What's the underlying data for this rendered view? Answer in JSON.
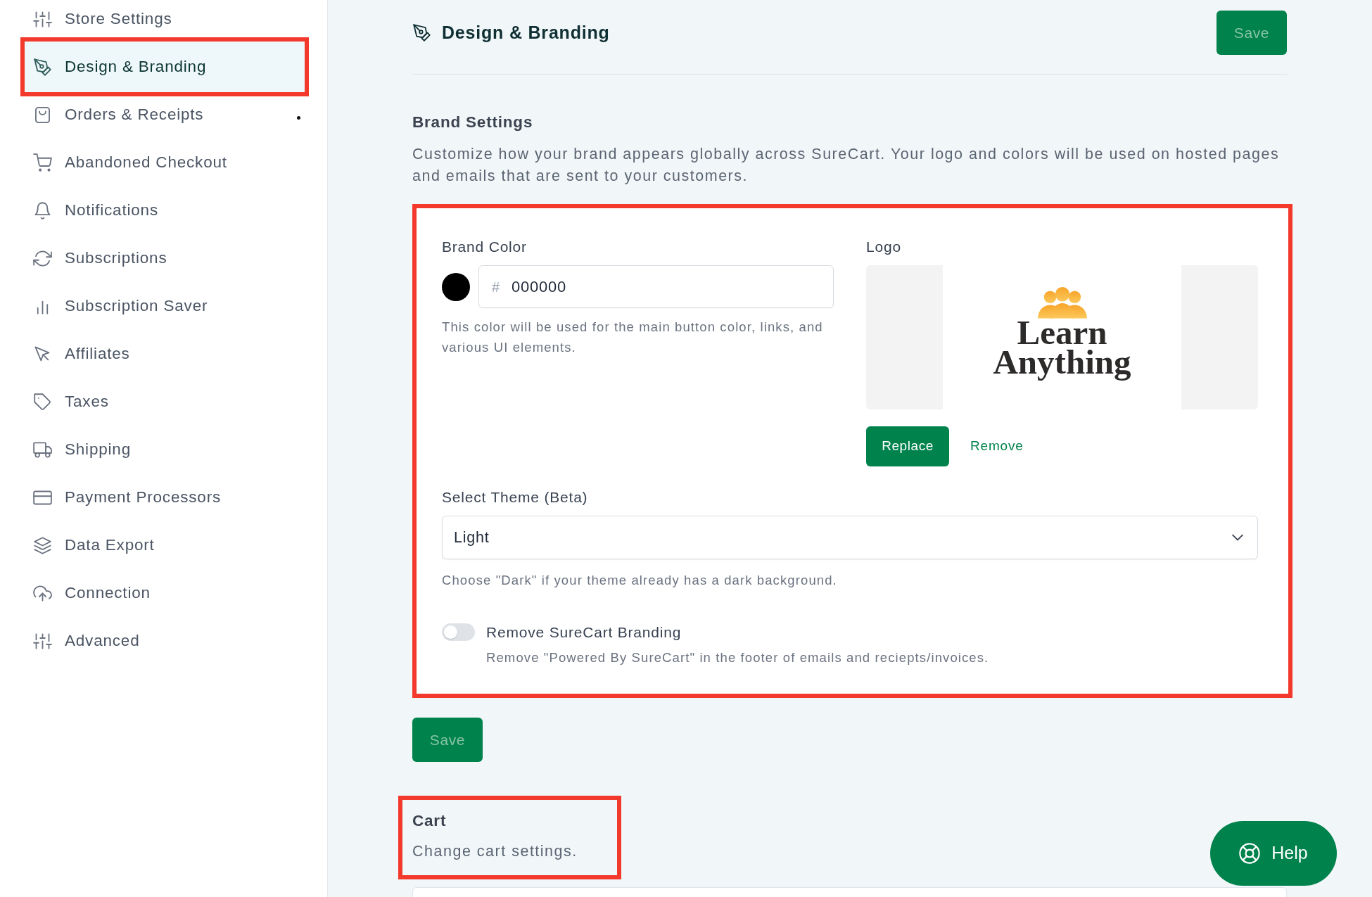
{
  "sidebar": {
    "items": [
      {
        "label": "Store Settings",
        "selected": false,
        "highlighted": false,
        "dot": false
      },
      {
        "label": "Design & Branding",
        "selected": true,
        "highlighted": true,
        "dot": false
      },
      {
        "label": "Orders & Receipts",
        "selected": false,
        "highlighted": false,
        "dot": true
      },
      {
        "label": "Abandoned Checkout",
        "selected": false,
        "highlighted": false,
        "dot": false
      },
      {
        "label": "Notifications",
        "selected": false,
        "highlighted": false,
        "dot": false
      },
      {
        "label": "Subscriptions",
        "selected": false,
        "highlighted": false,
        "dot": false
      },
      {
        "label": "Subscription Saver",
        "selected": false,
        "highlighted": false,
        "dot": false
      },
      {
        "label": "Affiliates",
        "selected": false,
        "highlighted": false,
        "dot": false
      },
      {
        "label": "Taxes",
        "selected": false,
        "highlighted": false,
        "dot": false
      },
      {
        "label": "Shipping",
        "selected": false,
        "highlighted": false,
        "dot": false
      },
      {
        "label": "Payment Processors",
        "selected": false,
        "highlighted": false,
        "dot": false
      },
      {
        "label": "Data Export",
        "selected": false,
        "highlighted": false,
        "dot": false
      },
      {
        "label": "Connection",
        "selected": false,
        "highlighted": false,
        "dot": false
      },
      {
        "label": "Advanced",
        "selected": false,
        "highlighted": false,
        "dot": false
      }
    ]
  },
  "header": {
    "title": "Design & Branding",
    "save_button": {
      "label": "Save",
      "disabled": true
    }
  },
  "brand_settings": {
    "title": "Brand Settings",
    "description": "Customize how your brand appears globally across SureCart. Your logo and colors will be used on hosted pages and emails that are sent to your customers.",
    "highlighted": true,
    "brand_color": {
      "label": "Brand Color",
      "prefix": "#",
      "value": "000000",
      "help": "This color will be used for the main button color, links, and various UI elements."
    },
    "logo": {
      "label": "Logo",
      "logo_text": "Learn Anything",
      "replace_button": "Replace",
      "remove_link": "Remove"
    },
    "theme": {
      "label": "Select Theme (Beta)",
      "value": "Light",
      "help": "Choose \"Dark\" if your theme already has a dark background."
    },
    "branding_toggle": {
      "label": "Remove SureCart Branding",
      "description": "Remove \"Powered By SureCart\" in the footer of emails and reciepts/invoices.",
      "on": false
    }
  },
  "save_button": {
    "label": "Save",
    "disabled": true
  },
  "cart": {
    "title": "Cart",
    "description": "Change cart settings.",
    "highlighted": true
  },
  "help_button": {
    "label": "Help"
  }
}
